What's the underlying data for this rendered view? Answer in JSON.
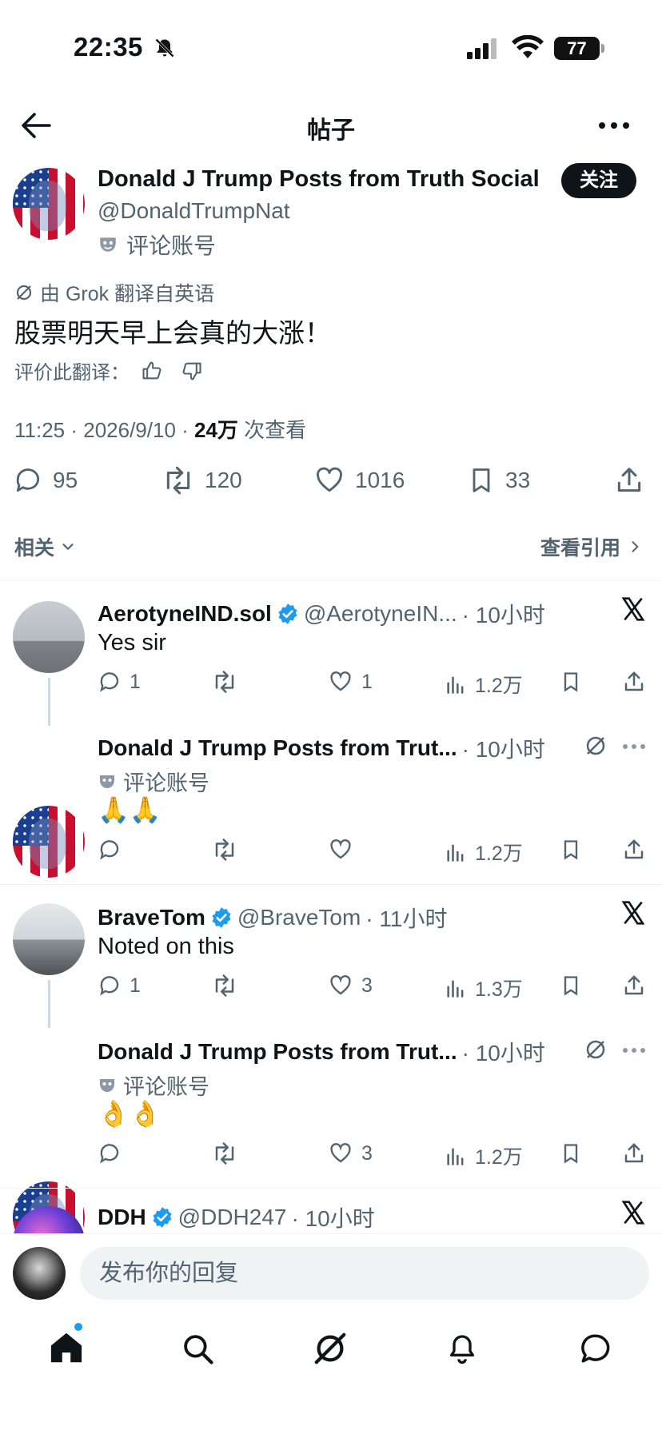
{
  "status_bar": {
    "time": "22:35",
    "battery": "77"
  },
  "header": {
    "title": "帖子"
  },
  "post": {
    "author_name": "Donald J Trump Posts from Truth Social",
    "author_handle": "@DonaldTrumpNat",
    "account_tag": "评论账号",
    "follow_label": "关注",
    "translated_note": "由 Grok 翻译自英语",
    "text": "股票明天早上会真的大涨！",
    "rate_label": "评价此翻译：",
    "time": "11:25 · 2026/9/10 · ",
    "views_count": "24万",
    "views_label": " 次查看",
    "stats": {
      "replies": "95",
      "reposts": "120",
      "likes": "1016",
      "bookmarks": "33"
    }
  },
  "tabs": {
    "related": "相关",
    "view_quotes": "查看引用"
  },
  "replies": [
    {
      "name": "AerotyneIND.sol",
      "handle": "@AerotyneIN...",
      "time": "· 10小时",
      "text": "Yes sir",
      "replies": "1",
      "reposts": "",
      "likes": "1",
      "views": "1.2万"
    },
    {
      "name": "Donald J Trump Posts from Trut...",
      "handle": "",
      "time": "· 10小时",
      "tag": "评论账号",
      "text": "🙏🙏",
      "replies": "",
      "reposts": "",
      "likes": "",
      "views": "1.2万"
    },
    {
      "name": "BraveTom",
      "handle": "@BraveTom",
      "time": "· 11小时",
      "text": "Noted on this",
      "replies": "1",
      "reposts": "",
      "likes": "3",
      "views": "1.3万"
    },
    {
      "name": "Donald J Trump Posts from Trut...",
      "handle": "",
      "time": "· 10小时",
      "tag": "评论账号",
      "text": "👌👌",
      "replies": "",
      "reposts": "",
      "likes": "3",
      "views": "1.2万"
    },
    {
      "name": "DDH",
      "handle": "@DDH247",
      "time": "· 10小时"
    }
  ],
  "composer": {
    "placeholder": "发布你的回复"
  },
  "colors": {
    "accent": "#1d9bf0",
    "text": "#0f1419",
    "muted": "#536471"
  }
}
